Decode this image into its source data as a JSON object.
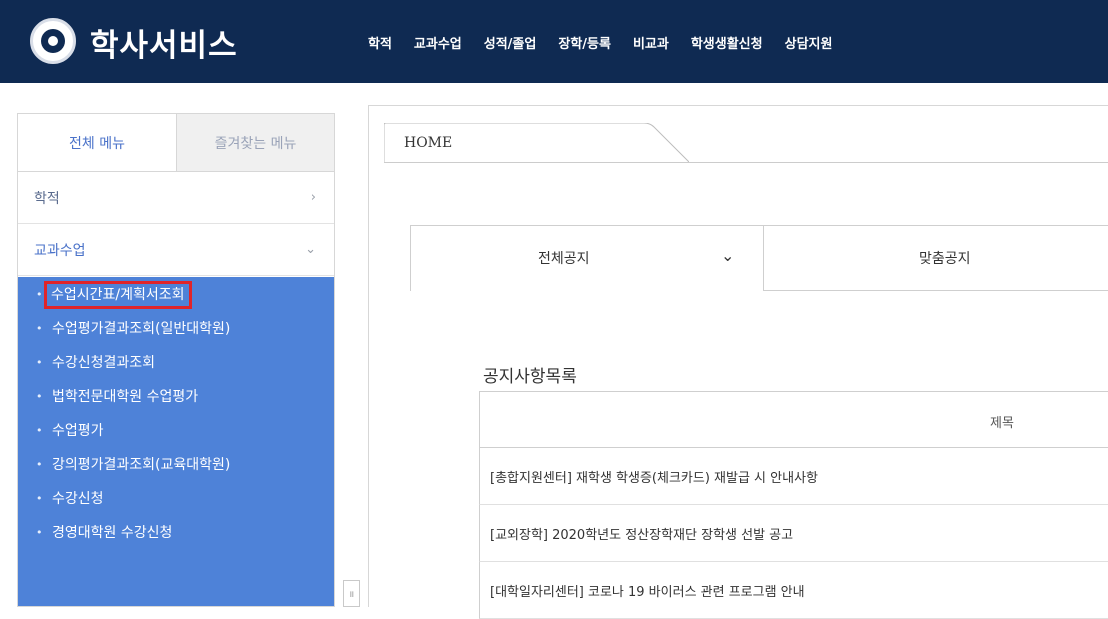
{
  "header": {
    "title": "학사서비스",
    "nav": [
      "학적",
      "교과수업",
      "성적/졸업",
      "장학/등록",
      "비교과",
      "학생생활신청",
      "상담지원"
    ]
  },
  "sidebar": {
    "tabs": {
      "all": "전체 메뉴",
      "favorites": "즐겨찾는 메뉴"
    },
    "menus": [
      {
        "label": "학적",
        "chevron": "›"
      },
      {
        "label": "교과수업",
        "chevron": "⌄"
      }
    ],
    "submenu": [
      "수업시간표/계획서조회",
      "수업평가결과조회(일반대학원)",
      "수강신청결과조회",
      "법학전문대학원 수업평가",
      "수업평가",
      "강의평가결과조회(교육대학원)",
      "수강신청",
      "경영대학원 수강신청"
    ],
    "collapse_label": "॥"
  },
  "main": {
    "tab": "HOME",
    "notice_tabs": {
      "all": "전체공지",
      "custom": "맞춤공지",
      "chevron": "⌄"
    },
    "list_title": "공지사항목록",
    "table": {
      "header": "제목",
      "rows": [
        "[총합지원센터] 재학생 학생증(체크카드) 재발급 시 안내사항",
        "[교외장학] 2020학년도 정산장학재단 장학생 선발 공고",
        "[대학일자리센터] 코로나 19 바이러스 관련 프로그램 안내"
      ]
    }
  },
  "colors": {
    "header_bg": "#0f2a52",
    "submenu_bg": "#4e82d8",
    "active_tab_text": "#4a72c9",
    "highlight_border": "#e0242a"
  }
}
